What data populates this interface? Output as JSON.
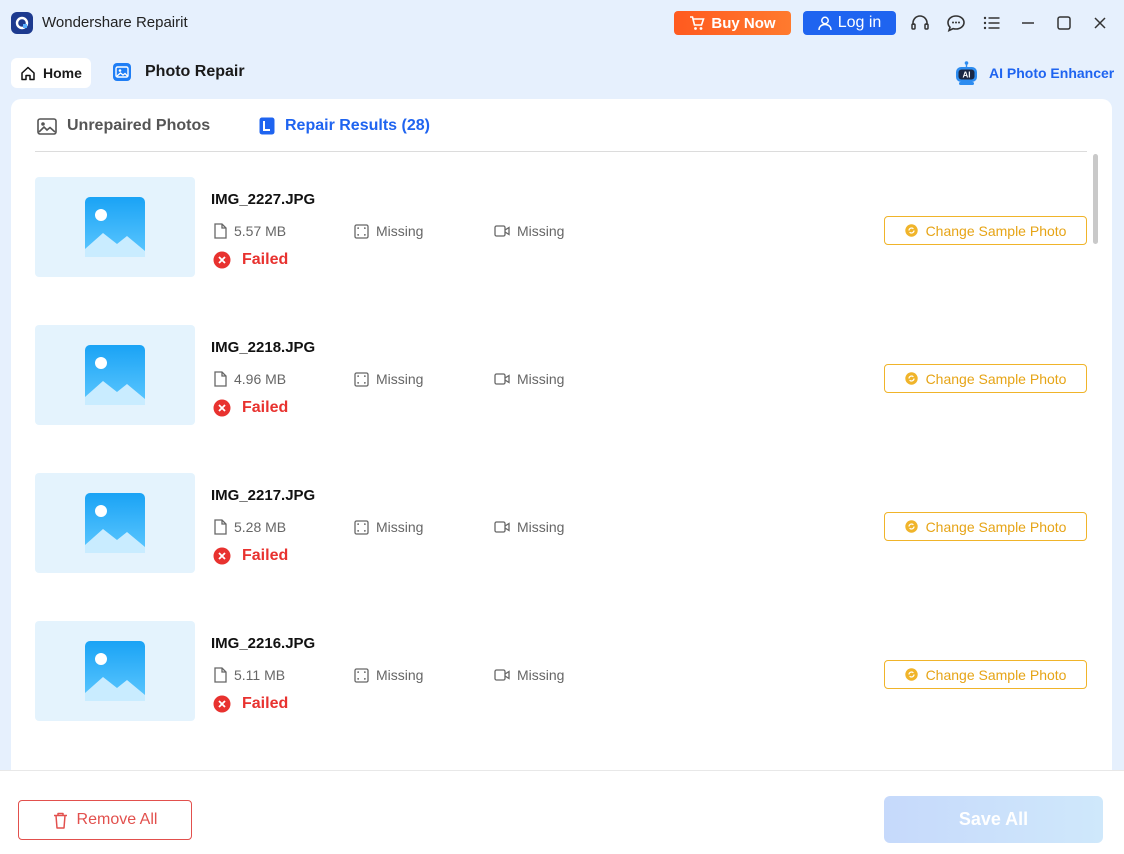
{
  "app": {
    "title": "Wondershare Repairit"
  },
  "titlebar": {
    "buy_label": "Buy Now",
    "login_label": "Log in",
    "icons": [
      "headset-icon",
      "chat-icon",
      "menu-list-icon",
      "minimize-icon",
      "maximize-icon",
      "close-icon"
    ]
  },
  "nav": {
    "home_label": "Home",
    "section_label": "Photo Repair",
    "ai_enhancer_label": "AI Photo Enhancer",
    "ai_badge": "AI"
  },
  "tabs": {
    "unrepaired_label": "Unrepaired Photos",
    "results_label": "Repair Results (28)"
  },
  "items": [
    {
      "name": "IMG_2227.JPG",
      "size": "5.57 MB",
      "resolution": "Missing",
      "camera": "Missing",
      "status": "Failed",
      "action": "Change Sample Photo"
    },
    {
      "name": "IMG_2218.JPG",
      "size": "4.96 MB",
      "resolution": "Missing",
      "camera": "Missing",
      "status": "Failed",
      "action": "Change Sample Photo"
    },
    {
      "name": "IMG_2217.JPG",
      "size": "5.28 MB",
      "resolution": "Missing",
      "camera": "Missing",
      "status": "Failed",
      "action": "Change Sample Photo"
    },
    {
      "name": "IMG_2216.JPG",
      "size": "5.11 MB",
      "resolution": "Missing",
      "camera": "Missing",
      "status": "Failed",
      "action": "Change Sample Photo"
    }
  ],
  "footer": {
    "remove_label": "Remove All",
    "save_label": "Save All"
  },
  "colors": {
    "accent": "#1f64f0",
    "buy": "#ff5a1f",
    "failed": "#e8322f",
    "warning": "#f0b42a",
    "background": "#e6f0fd"
  }
}
